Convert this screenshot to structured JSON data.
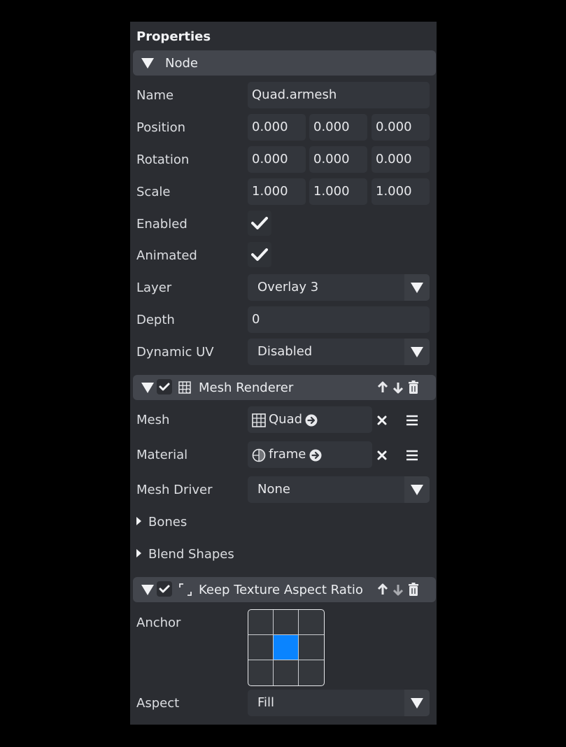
{
  "panel": {
    "title": "Properties"
  },
  "node": {
    "header": "Node",
    "name_label": "Name",
    "name_value": "Quad.armesh",
    "position_label": "Position",
    "position": [
      "0.000",
      "0.000",
      "0.000"
    ],
    "rotation_label": "Rotation",
    "rotation": [
      "0.000",
      "0.000",
      "0.000"
    ],
    "scale_label": "Scale",
    "scale": [
      "1.000",
      "1.000",
      "1.000"
    ],
    "enabled_label": "Enabled",
    "enabled": true,
    "animated_label": "Animated",
    "animated": true,
    "layer_label": "Layer",
    "layer_value": "Overlay 3",
    "depth_label": "Depth",
    "depth_value": "0",
    "dynamic_uv_label": "Dynamic UV",
    "dynamic_uv_value": "Disabled"
  },
  "mesh_renderer": {
    "header": "Mesh Renderer",
    "enabled": true,
    "mesh_label": "Mesh",
    "mesh_value": "Quad",
    "material_label": "Material",
    "material_value": "frame",
    "mesh_driver_label": "Mesh Driver",
    "mesh_driver_value": "None",
    "bones_label": "Bones",
    "blend_shapes_label": "Blend Shapes"
  },
  "keep_aspect": {
    "header": "Keep Texture Aspect Ratio",
    "enabled": true,
    "anchor_label": "Anchor",
    "anchor_selected": "center",
    "aspect_label": "Aspect",
    "aspect_value": "Fill"
  },
  "colors": {
    "accent": "#0a84ff",
    "panel_bg": "#2b2d32",
    "header_bg": "#43464d",
    "field_bg": "#33363c"
  },
  "icons": [
    "collapse-triangle-icon",
    "checkmark-icon",
    "mesh-renderer-icon",
    "arrow-up-icon",
    "arrow-down-icon",
    "trash-icon",
    "mesh-grid-icon",
    "material-sphere-icon",
    "navigate-arrow-icon",
    "clear-x-icon",
    "menu-lines-icon",
    "dropdown-arrow-icon",
    "aspect-corners-icon"
  ]
}
